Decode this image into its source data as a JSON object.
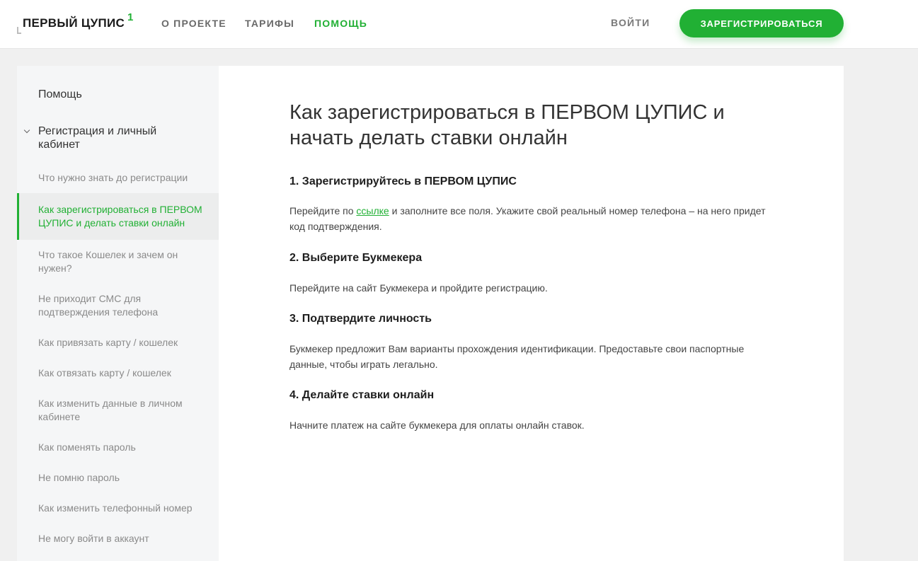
{
  "header": {
    "logo_text": "ПЕРВЫЙ ЦУПИС",
    "logo_superscript": "1",
    "nav": [
      "О ПРОЕКТЕ",
      "ТАРИФЫ",
      "ПОМОЩЬ"
    ],
    "active_nav": "ПОМОЩЬ",
    "login_label": "ВОЙТИ",
    "register_label": "ЗАРЕГИСТРИРОВАТЬСЯ"
  },
  "sidebar": {
    "help_label": "Помощь",
    "section_label": "Регистрация и личный кабинет",
    "items": [
      "Что нужно знать до регистрации",
      "Как зарегистрироваться в ПЕРВОМ ЦУПИС и делать ставки онлайн",
      "Что такое Кошелек и зачем он нужен?",
      "Не приходит СМС для подтверждения телефона",
      "Как привязать карту / кошелек",
      "Как отвязать карту / кошелек",
      "Как изменить данные в личном кабинете",
      "Как поменять пароль",
      "Не помню пароль",
      "Как изменить телефонный номер",
      "Не могу войти в аккаунт"
    ],
    "active_item": "Как зарегистрироваться в ПЕРВОМ ЦУПИС и делать ставки онлайн"
  },
  "article": {
    "title": "Как зарегистрироваться в ПЕРВОМ ЦУПИС и начать делать ставки онлайн",
    "steps": [
      {
        "heading": "1. Зарегистрируйтесь в ПЕРВОМ ЦУПИС",
        "text_before": "Перейдите по ",
        "link": "ссылке",
        "text_after": " и заполните все поля. Укажите свой реальный номер телефона – на него придет код подтверждения."
      },
      {
        "heading": "2. Выберите Букмекера",
        "text": "Перейдите на сайт Букмекера и пройдите регистрацию."
      },
      {
        "heading": "3. Подтвердите личность",
        "text": "Букмекер предложит Вам варианты прохождения идентификации. Предоставьте свои паспортные данные, чтобы играть легально."
      },
      {
        "heading": "4. Делайте ставки онлайн",
        "text": "Начните платеж на сайте букмекера для оплаты онлайн ставок."
      }
    ]
  },
  "colors": {
    "accent": "#21b034",
    "background": "#f0f0f0",
    "sidebar": "#f5f6f7"
  }
}
